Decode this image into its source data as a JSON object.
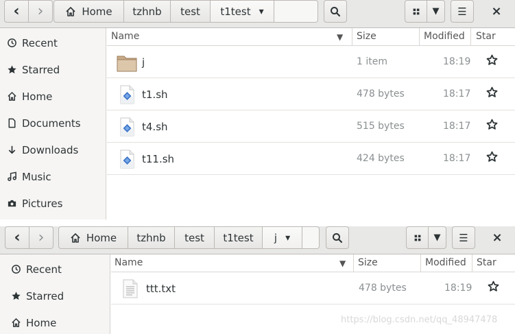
{
  "window1": {
    "nav": {
      "back_icon": "‹",
      "forward_icon": "›"
    },
    "breadcrumbs": [
      {
        "label": "Home",
        "icon": "home-icon"
      },
      {
        "label": "tzhnb"
      },
      {
        "label": "test"
      },
      {
        "label": "t1test",
        "dropdown": "▾"
      }
    ],
    "toolbar": {
      "search_icon": "search-icon",
      "grid_icon": "grid-icon",
      "menu_icon": "☰",
      "close": "×"
    },
    "sidebar": [
      {
        "label": "Recent",
        "icon": "recent-icon"
      },
      {
        "label": "Starred",
        "icon": "star-icon"
      },
      {
        "label": "Home",
        "icon": "home-icon"
      },
      {
        "label": "Documents",
        "icon": "document-icon"
      },
      {
        "label": "Downloads",
        "icon": "download-icon"
      },
      {
        "label": "Music",
        "icon": "music-icon"
      },
      {
        "label": "Pictures",
        "icon": "camera-icon"
      }
    ],
    "columns": {
      "name": "Name",
      "size": "Size",
      "modified": "Modified",
      "star": "Star"
    },
    "files": [
      {
        "name": "j",
        "type": "folder",
        "size": "1 item",
        "modified": "18:19"
      },
      {
        "name": "t1.sh",
        "type": "script",
        "size": "478 bytes",
        "modified": "18:17"
      },
      {
        "name": "t4.sh",
        "type": "script",
        "size": "515 bytes",
        "modified": "18:17"
      },
      {
        "name": "t11.sh",
        "type": "script",
        "size": "424 bytes",
        "modified": "18:17"
      }
    ]
  },
  "window2": {
    "breadcrumbs": [
      {
        "label": "Home"
      },
      {
        "label": "tzhnb"
      },
      {
        "label": "test"
      },
      {
        "label": "t1test"
      },
      {
        "label": "j",
        "dropdown": "▾"
      }
    ],
    "sidebar": [
      {
        "label": "Recent"
      },
      {
        "label": "Starred"
      },
      {
        "label": "Home"
      }
    ],
    "columns": {
      "name": "Name",
      "size": "Size",
      "modified": "Modified",
      "star": "Star"
    },
    "files": [
      {
        "name": "ttt.txt",
        "type": "text",
        "size": "478 bytes",
        "modified": "18:19"
      }
    ],
    "watermark": "https://blog.csdn.net/qq_48947478"
  }
}
